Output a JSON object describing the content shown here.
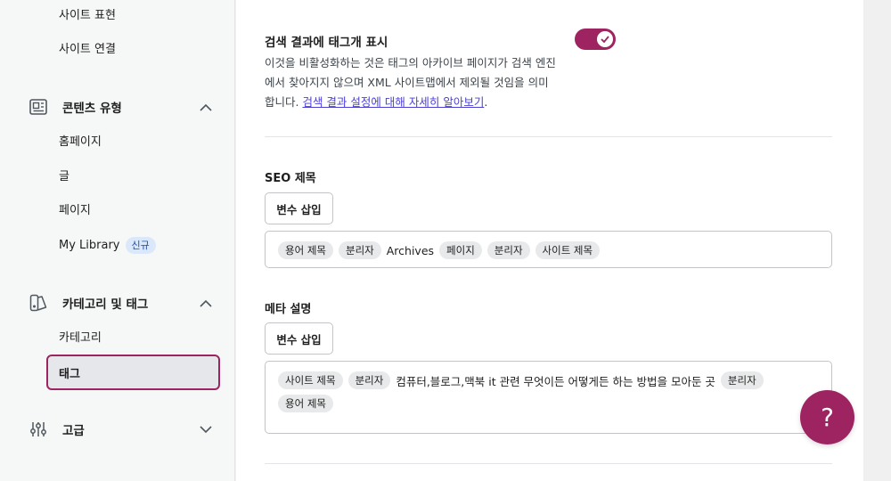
{
  "sidebar": {
    "top_items": [
      {
        "label": "사이트 표현"
      },
      {
        "label": "사이트 연결"
      }
    ],
    "content_types": {
      "label": "콘텐츠 유형",
      "icon": "content-types-icon",
      "items": [
        {
          "label": "홈페이지"
        },
        {
          "label": "글"
        },
        {
          "label": "페이지"
        },
        {
          "label": "My Library",
          "badge": "신규"
        }
      ]
    },
    "taxonomies": {
      "label": "카테고리 및 태그",
      "icon": "categories-tags-icon",
      "items": [
        {
          "label": "카테고리"
        },
        {
          "label": "태그",
          "active": true
        }
      ]
    },
    "advanced": {
      "label": "고급",
      "icon": "sliders-icon"
    }
  },
  "main": {
    "show_in_search": {
      "title": "검색 결과에 태그개 표시",
      "desc_before": "이것을 비활성화하는 것은 태그의 아카이브 페이지가 검색 엔진에서 찾아지지 않으며 XML 사이트맵에서 제외될 것임을 의미합니다. ",
      "link": "검색 결과 설정에 대해 자세히 알아보기",
      "desc_after": ".",
      "enabled": true
    },
    "seo_title": {
      "label": "SEO 제목",
      "insert_variable": "변수 삽입",
      "parts": [
        {
          "type": "chip",
          "text": "용어 제목"
        },
        {
          "type": "chip",
          "text": "분리자"
        },
        {
          "type": "text",
          "text": "Archives"
        },
        {
          "type": "chip",
          "text": "페이지"
        },
        {
          "type": "chip",
          "text": "분리자"
        },
        {
          "type": "chip",
          "text": "사이트 제목"
        }
      ]
    },
    "meta_description": {
      "label": "메타 설명",
      "insert_variable": "변수 삽입",
      "line1": [
        {
          "type": "chip",
          "text": "사이트 제목"
        },
        {
          "type": "chip",
          "text": "분리자"
        },
        {
          "type": "text",
          "text": "컴퓨터,블로그,맥북 it 관련 무엇이든 어떻게든 하는 방법을 모아둔 곳"
        },
        {
          "type": "chip",
          "text": "분리자"
        }
      ],
      "line2": [
        {
          "type": "chip",
          "text": "용어 제목"
        }
      ]
    }
  },
  "help": {
    "label": "?"
  },
  "colors": {
    "accent": "#9d2461",
    "link": "#4b3fd4",
    "badge_bg": "#dbe8fb"
  }
}
